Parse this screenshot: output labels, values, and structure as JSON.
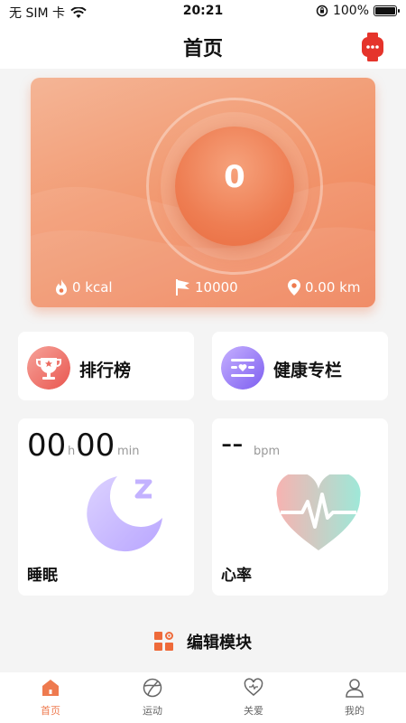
{
  "status_bar": {
    "carrier": "无 SIM 卡",
    "time": "20:21",
    "battery": "100%",
    "battery_level": 1.0
  },
  "header": {
    "title": "首页",
    "right_icon": "watch-icon"
  },
  "hero": {
    "steps": "0",
    "calories": "0 kcal",
    "goal": "10000",
    "distance": "0.00 km",
    "colors": {
      "start": "#f4b596",
      "end": "#ee7a4f"
    }
  },
  "nav_cards": [
    {
      "label": "排行榜",
      "icon": "trophy-icon"
    },
    {
      "label": "健康专栏",
      "icon": "health-column-icon"
    }
  ],
  "sleep": {
    "hours": "00",
    "hours_unit": "h",
    "minutes": "00",
    "minutes_unit": "min",
    "label": "睡眠",
    "icon": "moon-icon"
  },
  "heart": {
    "value": "--",
    "unit": "bpm",
    "label": "心率",
    "icon": "heart-rate-icon"
  },
  "edit": {
    "label": "编辑模块",
    "icon": "grid-settings-icon"
  },
  "tabs": [
    {
      "label": "首页",
      "icon": "home-icon",
      "active": true
    },
    {
      "label": "运动",
      "icon": "sport-icon",
      "active": false
    },
    {
      "label": "关爱",
      "icon": "care-icon",
      "active": false
    },
    {
      "label": "我的",
      "icon": "profile-icon",
      "active": false
    }
  ],
  "accent_color": "#ee7a4f"
}
